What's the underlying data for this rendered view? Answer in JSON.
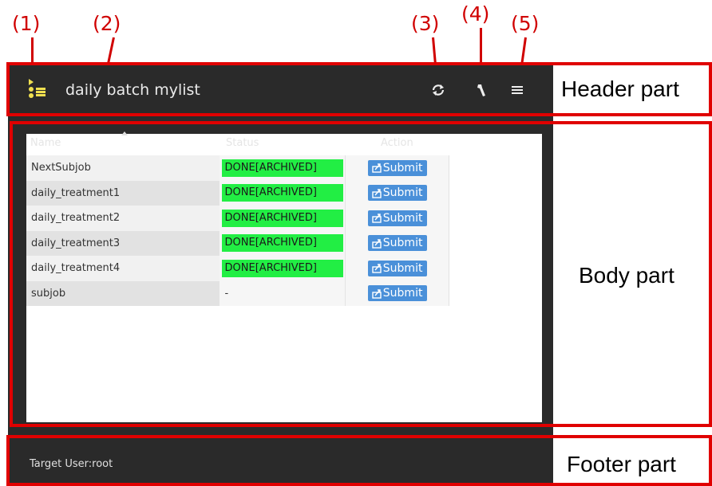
{
  "callouts": [
    "(1)",
    "(2)",
    "(3)",
    "(4)",
    "(5)"
  ],
  "side_labels": {
    "header": "Header part",
    "body": "Body part",
    "footer": "Footer part"
  },
  "header": {
    "title": "daily batch mylist",
    "icons": [
      "list-logo-icon",
      "refresh-icon",
      "wrench-icon",
      "menu-icon"
    ]
  },
  "table": {
    "columns": [
      "Name",
      "Status",
      "Action"
    ],
    "rows": [
      {
        "name": "NextSubjob",
        "status": "DONE[ARCHIVED]",
        "action": "Submit"
      },
      {
        "name": "daily_treatment1",
        "status": "DONE[ARCHIVED]",
        "action": "Submit"
      },
      {
        "name": "daily_treatment2",
        "status": "DONE[ARCHIVED]",
        "action": "Submit"
      },
      {
        "name": "daily_treatment3",
        "status": "DONE[ARCHIVED]",
        "action": "Submit"
      },
      {
        "name": "daily_treatment4",
        "status": "DONE[ARCHIVED]",
        "action": "Submit"
      },
      {
        "name": "subjob",
        "status": "-",
        "action": "Submit"
      }
    ]
  },
  "footer": {
    "text": "Target User:root"
  },
  "colors": {
    "annotation": "#e00000",
    "done_status": "#22ee44",
    "submit_button": "#4a90d9",
    "dark_bg": "#2a2a2a"
  }
}
